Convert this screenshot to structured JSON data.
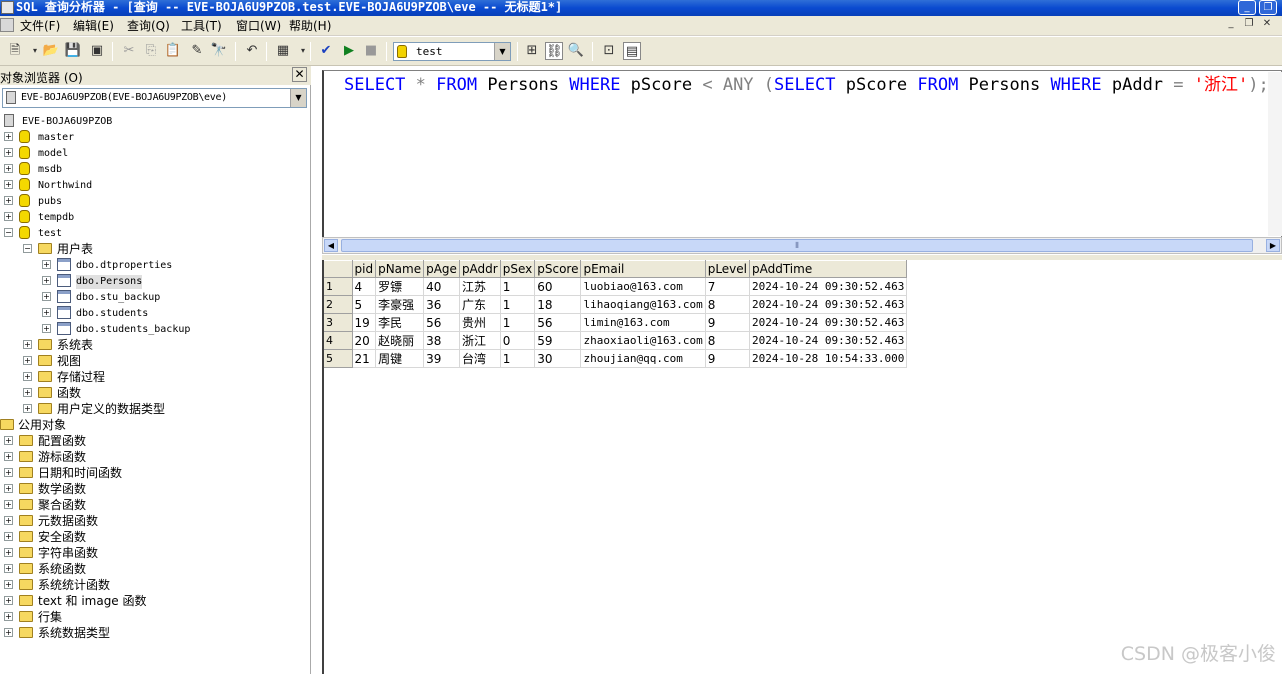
{
  "titlebar": {
    "title": "SQL 查询分析器 - [查询 -- EVE-BOJA6U9PZOB.test.EVE-BOJA6U9PZOB\\eve -- 无标题1*]"
  },
  "menubar": [
    "文件(F)",
    "编辑(E)",
    "查询(Q)",
    "工具(T)",
    "窗口(W)",
    "帮助(H)"
  ],
  "toolbar": {
    "database": "test"
  },
  "object_browser": {
    "title": "对象浏览器 (O)",
    "close": "✕",
    "server_combo": "EVE-BOJA6U9PZOB(EVE-BOJA6U9PZOB\\eve)",
    "tree": [
      {
        "label": "EVE-BOJA6U9PZOB",
        "type": "server",
        "level": 0,
        "expand": "",
        "mono": true
      },
      {
        "label": "master",
        "type": "db",
        "level": 0,
        "expand": "+",
        "mono": true
      },
      {
        "label": "model",
        "type": "db",
        "level": 0,
        "expand": "+",
        "mono": true
      },
      {
        "label": "msdb",
        "type": "db",
        "level": 0,
        "expand": "+",
        "mono": true
      },
      {
        "label": "Northwind",
        "type": "db",
        "level": 0,
        "expand": "+",
        "mono": true
      },
      {
        "label": "pubs",
        "type": "db",
        "level": 0,
        "expand": "+",
        "mono": true
      },
      {
        "label": "tempdb",
        "type": "db",
        "level": 0,
        "expand": "+",
        "mono": true
      },
      {
        "label": "test",
        "type": "db",
        "level": 0,
        "expand": "−",
        "mono": true
      },
      {
        "label": "用户表",
        "type": "folder",
        "level": 1,
        "expand": "−",
        "mono": false
      },
      {
        "label": "dbo.dtproperties",
        "type": "table",
        "level": 2,
        "expand": "+",
        "mono": true
      },
      {
        "label": "dbo.Persons",
        "type": "table",
        "level": 2,
        "expand": "+",
        "mono": true,
        "selected": true
      },
      {
        "label": "dbo.stu_backup",
        "type": "table",
        "level": 2,
        "expand": "+",
        "mono": true
      },
      {
        "label": "dbo.students",
        "type": "table",
        "level": 2,
        "expand": "+",
        "mono": true
      },
      {
        "label": "dbo.students_backup",
        "type": "table",
        "level": 2,
        "expand": "+",
        "mono": true
      },
      {
        "label": "系统表",
        "type": "folder",
        "level": 1,
        "expand": "+",
        "mono": false
      },
      {
        "label": "视图",
        "type": "folder",
        "level": 1,
        "expand": "+",
        "mono": false
      },
      {
        "label": "存储过程",
        "type": "folder",
        "level": 1,
        "expand": "+",
        "mono": false
      },
      {
        "label": "函数",
        "type": "folder",
        "level": 1,
        "expand": "+",
        "mono": false
      },
      {
        "label": "用户定义的数据类型",
        "type": "folder",
        "level": 1,
        "expand": "+",
        "mono": false
      },
      {
        "label": "公用对象",
        "type": "folder",
        "level": -1,
        "expand": "",
        "mono": false
      },
      {
        "label": "配置函数",
        "type": "folder",
        "level": 0,
        "expand": "+",
        "mono": false
      },
      {
        "label": "游标函数",
        "type": "folder",
        "level": 0,
        "expand": "+",
        "mono": false
      },
      {
        "label": "日期和时间函数",
        "type": "folder",
        "level": 0,
        "expand": "+",
        "mono": false
      },
      {
        "label": "数学函数",
        "type": "folder",
        "level": 0,
        "expand": "+",
        "mono": false
      },
      {
        "label": "聚合函数",
        "type": "folder",
        "level": 0,
        "expand": "+",
        "mono": false
      },
      {
        "label": "元数据函数",
        "type": "folder",
        "level": 0,
        "expand": "+",
        "mono": false
      },
      {
        "label": "安全函数",
        "type": "folder",
        "level": 0,
        "expand": "+",
        "mono": false
      },
      {
        "label": "字符串函数",
        "type": "folder",
        "level": 0,
        "expand": "+",
        "mono": false
      },
      {
        "label": "系统函数",
        "type": "folder",
        "level": 0,
        "expand": "+",
        "mono": false
      },
      {
        "label": "系统统计函数",
        "type": "folder",
        "level": 0,
        "expand": "+",
        "mono": false
      },
      {
        "label": "text 和 image 函数",
        "type": "folder",
        "level": 0,
        "expand": "+",
        "mono": false
      },
      {
        "label": "行集",
        "type": "folder",
        "level": 0,
        "expand": "+",
        "mono": false
      },
      {
        "label": "系统数据类型",
        "type": "folder",
        "level": 0,
        "expand": "+",
        "mono": false
      }
    ]
  },
  "editor": {
    "tokens": [
      {
        "t": "SELECT",
        "c": "kw"
      },
      {
        "t": " ",
        "c": "id"
      },
      {
        "t": "*",
        "c": "op"
      },
      {
        "t": " ",
        "c": "id"
      },
      {
        "t": "FROM",
        "c": "kw"
      },
      {
        "t": " Persons ",
        "c": "id"
      },
      {
        "t": "WHERE",
        "c": "kw"
      },
      {
        "t": " pScore ",
        "c": "id"
      },
      {
        "t": "<",
        "c": "op"
      },
      {
        "t": " ",
        "c": "id"
      },
      {
        "t": "ANY",
        "c": "op"
      },
      {
        "t": " ",
        "c": "id"
      },
      {
        "t": "(",
        "c": "op"
      },
      {
        "t": "SELECT",
        "c": "kw"
      },
      {
        "t": " pScore ",
        "c": "id"
      },
      {
        "t": "FROM",
        "c": "kw"
      },
      {
        "t": " Persons ",
        "c": "id"
      },
      {
        "t": "WHERE",
        "c": "kw"
      },
      {
        "t": " pAddr ",
        "c": "id"
      },
      {
        "t": "=",
        "c": "op"
      },
      {
        "t": " ",
        "c": "id"
      },
      {
        "t": "'浙江'",
        "c": "str"
      },
      {
        "t": ");",
        "c": "op"
      }
    ]
  },
  "results": {
    "columns": [
      "pid",
      "pName",
      "pAge",
      "pAddr",
      "pSex",
      "pScore",
      "pEmail",
      "pLevel",
      "pAddTime"
    ],
    "rows": [
      [
        "4",
        "罗镖",
        "40",
        "江苏",
        "1",
        "60",
        "luobiao@163.com",
        "7",
        "2024-10-24 09:30:52.463"
      ],
      [
        "5",
        "李豪强",
        "36",
        "广东",
        "1",
        "18",
        "lihaoqiang@163.com",
        "8",
        "2024-10-24 09:30:52.463"
      ],
      [
        "19",
        "李民",
        "56",
        "贵州",
        "1",
        "56",
        "limin@163.com",
        "9",
        "2024-10-24 09:30:52.463"
      ],
      [
        "20",
        "赵晓丽",
        "38",
        "浙江",
        "0",
        "59",
        "zhaoxiaoli@163.com",
        "8",
        "2024-10-24 09:30:52.463"
      ],
      [
        "21",
        "周键",
        "39",
        "台湾",
        "1",
        "30",
        "zhoujian@qq.com",
        "9",
        "2024-10-28 10:54:33.000"
      ]
    ]
  },
  "watermark": "CSDN @极客小俊"
}
